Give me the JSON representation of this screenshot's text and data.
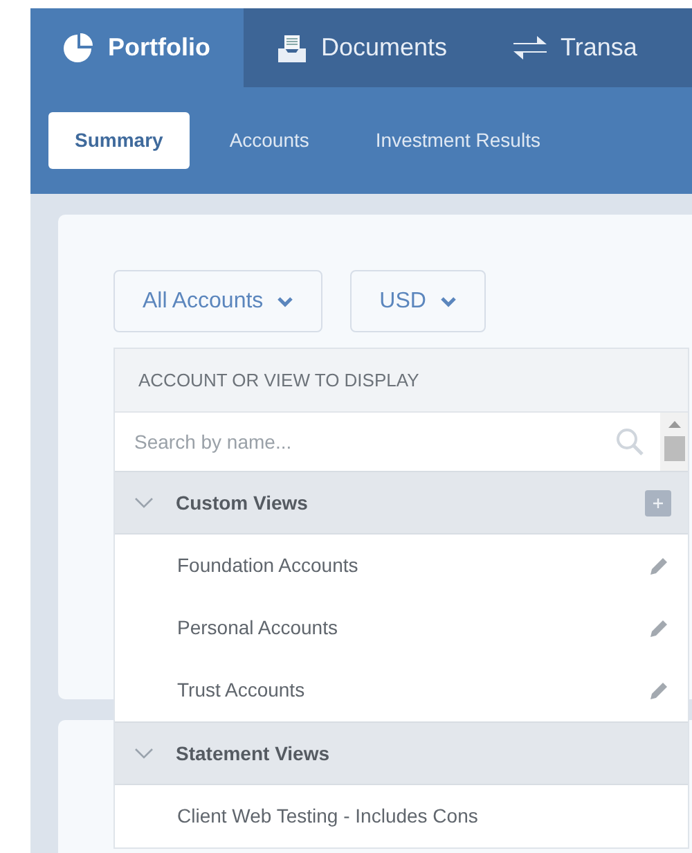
{
  "main_tabs": [
    {
      "label": "Portfolio",
      "selected": true
    },
    {
      "label": "Documents",
      "selected": false
    },
    {
      "label": "Transa",
      "selected": false
    }
  ],
  "sub_tabs": [
    {
      "label": "Summary",
      "selected": true
    },
    {
      "label": "Accounts",
      "selected": false
    },
    {
      "label": "Investment Results",
      "selected": false
    }
  ],
  "filters": [
    {
      "label": "All Accounts"
    },
    {
      "label": "USD"
    }
  ],
  "dropdown": {
    "heading": "ACCOUNT OR VIEW TO DISPLAY",
    "search": {
      "placeholder": "Search by name..."
    },
    "groups": [
      {
        "label": "Custom Views",
        "expanded": true,
        "addable": true,
        "items": [
          {
            "label": "Foundation Accounts",
            "editable": true
          },
          {
            "label": "Personal Accounts",
            "editable": true
          },
          {
            "label": "Trust Accounts",
            "editable": true
          }
        ]
      },
      {
        "label": "Statement Views",
        "expanded": true,
        "addable": false,
        "items": [
          {
            "label": "Client Web Testing - Includes Cons",
            "editable": false
          }
        ]
      }
    ]
  }
}
